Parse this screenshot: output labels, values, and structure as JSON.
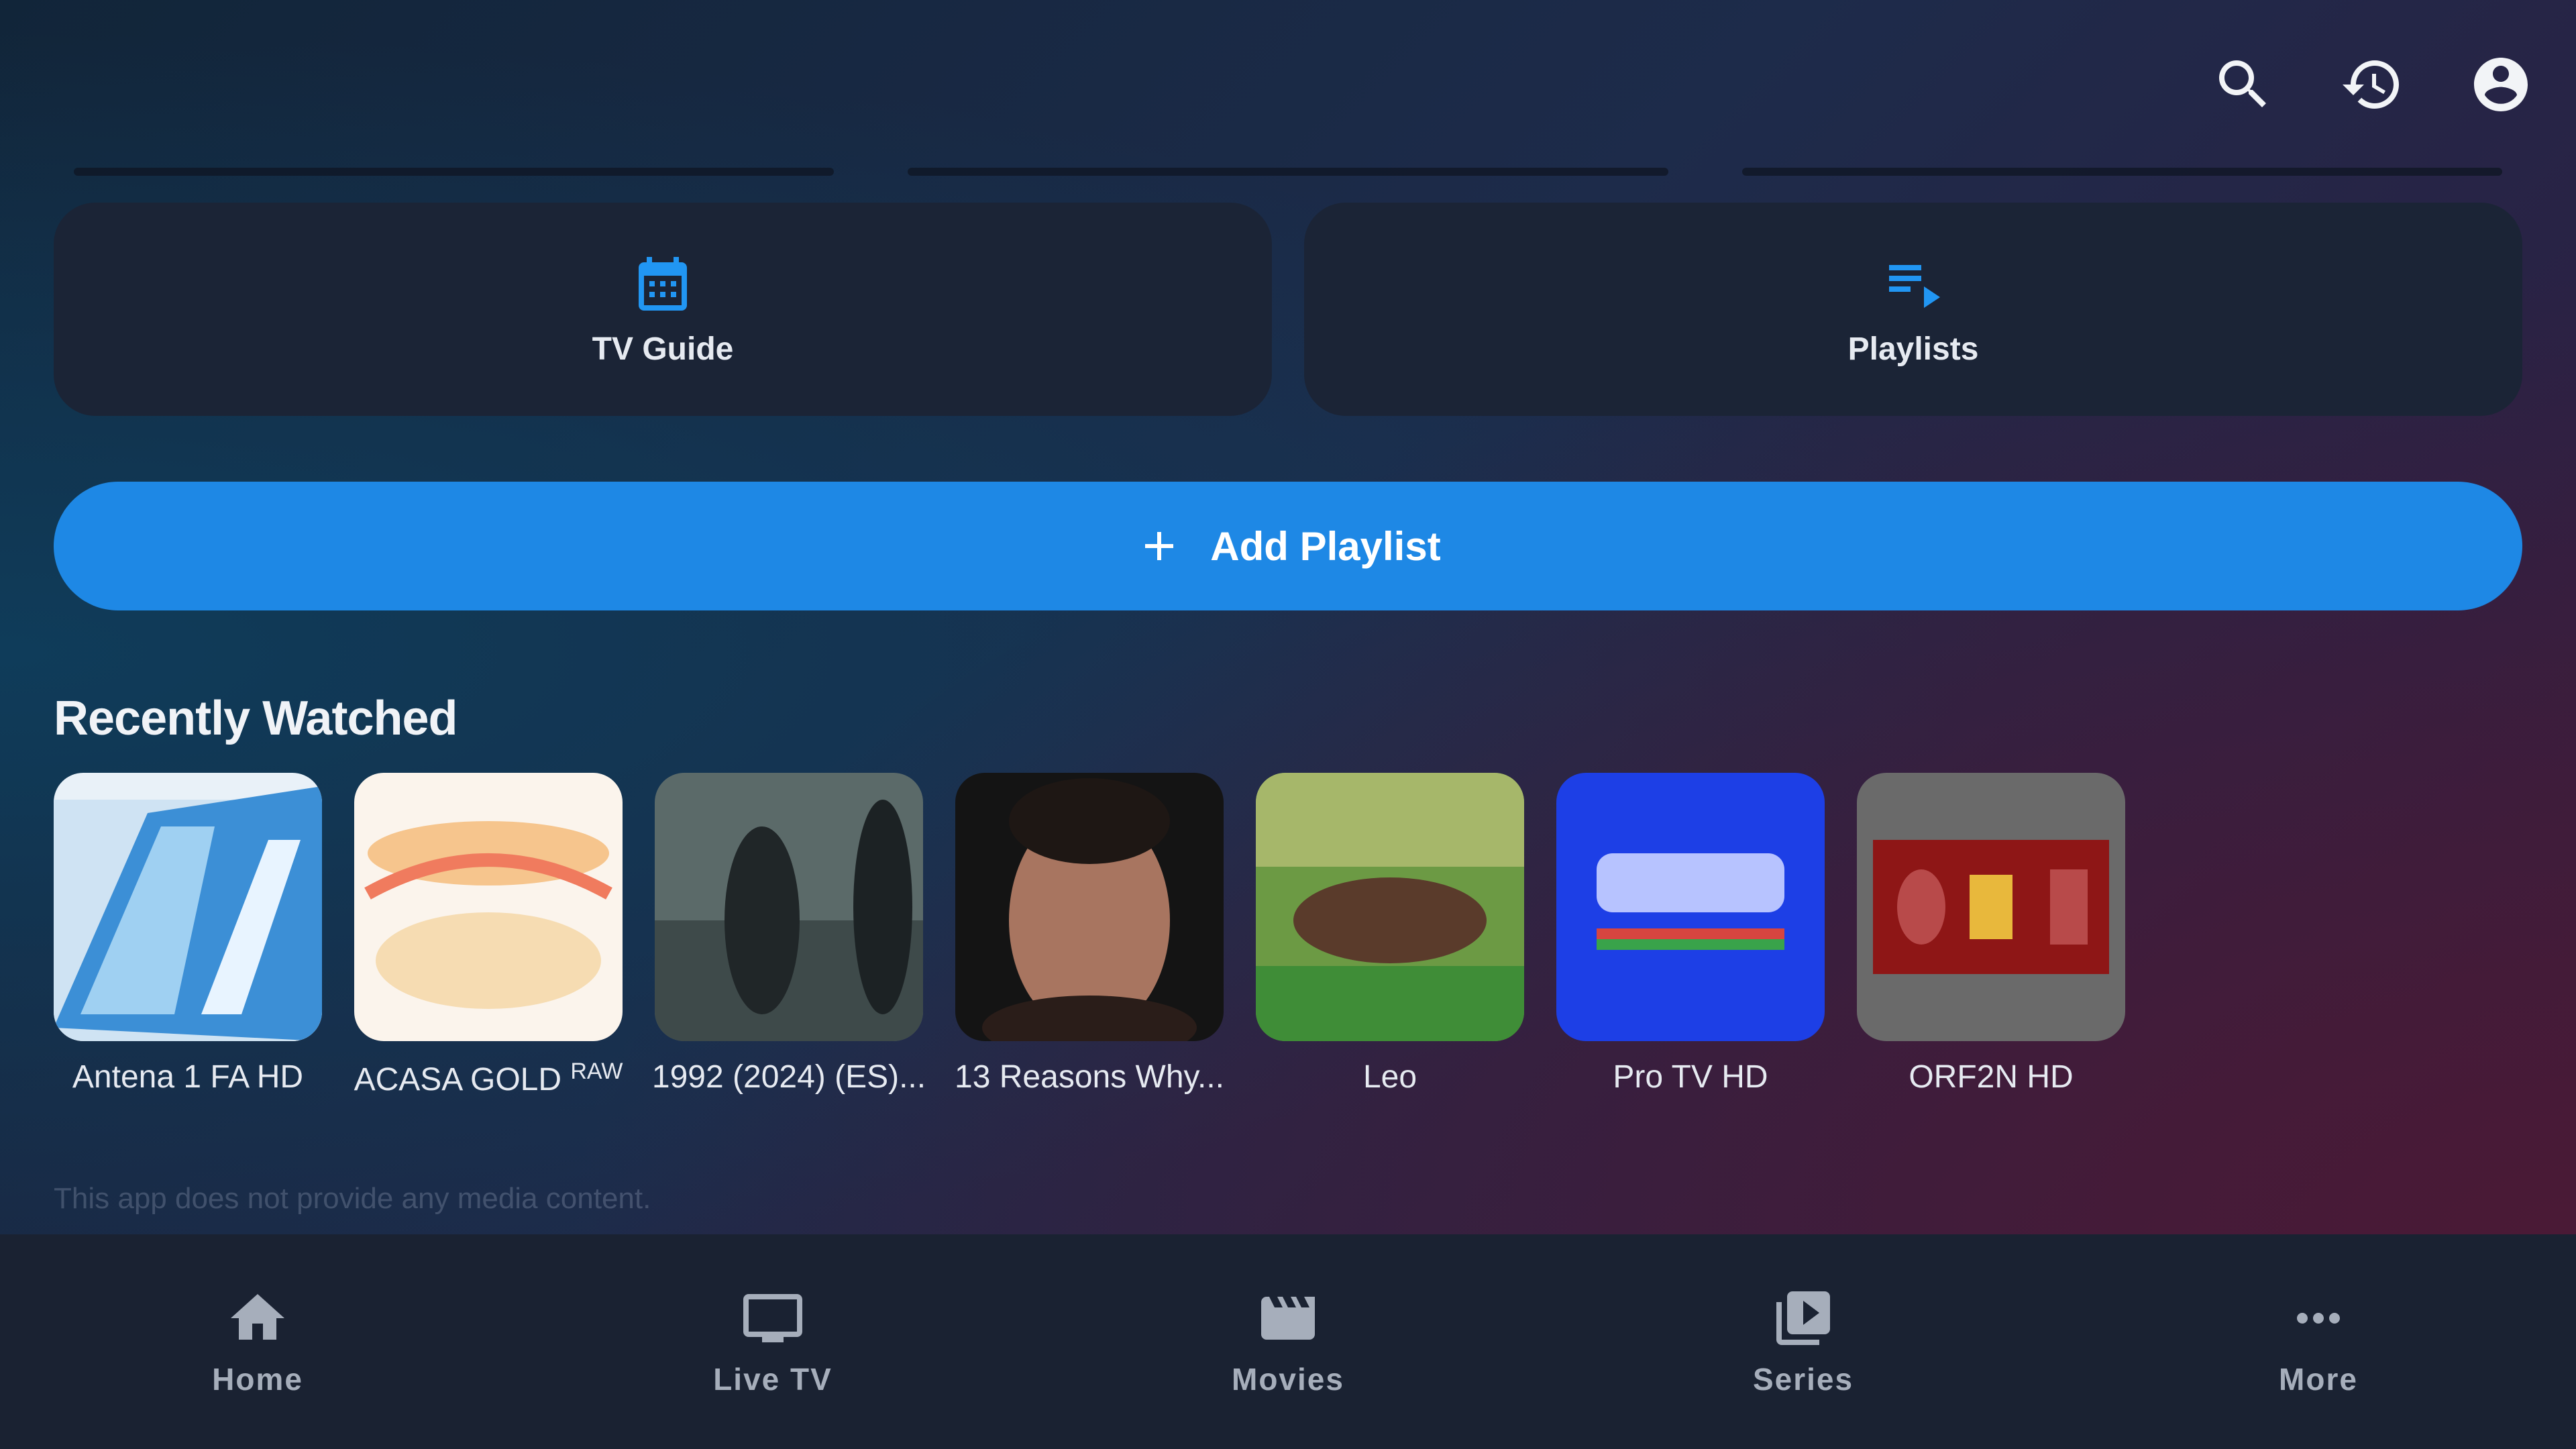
{
  "header": {
    "icons": [
      "search-icon",
      "history-icon",
      "account-icon"
    ]
  },
  "cards": [
    {
      "label": "TV Guide",
      "icon": "calendar-icon"
    },
    {
      "label": "Playlists",
      "icon": "playlist-icon"
    }
  ],
  "add_playlist": {
    "label": "Add Playlist",
    "icon": "plus-icon"
  },
  "recently_watched": {
    "title": "Recently Watched",
    "items": [
      {
        "label": "Antena 1 FA  HD",
        "superscript": ""
      },
      {
        "label": "ACASA GOLD",
        "superscript": "RAW"
      },
      {
        "label": "1992 (2024) (ES)...",
        "superscript": ""
      },
      {
        "label": "13 Reasons Why...",
        "superscript": ""
      },
      {
        "label": "Leo",
        "superscript": ""
      },
      {
        "label": "Pro TV HD",
        "superscript": ""
      },
      {
        "label": "ORF2N HD",
        "superscript": ""
      }
    ]
  },
  "disclaimer": "This app does not provide any media content.",
  "nav": [
    {
      "label": "Home",
      "icon": "home-icon"
    },
    {
      "label": "Live TV",
      "icon": "tv-icon"
    },
    {
      "label": "Movies",
      "icon": "movie-icon"
    },
    {
      "label": "Series",
      "icon": "series-icon"
    },
    {
      "label": "More",
      "icon": "more-icon"
    }
  ],
  "colors": {
    "accent": "#1e88e5",
    "card_bg": "#1b2436",
    "nav_bg": "#1a2232",
    "nav_text": "#a6aebb"
  }
}
